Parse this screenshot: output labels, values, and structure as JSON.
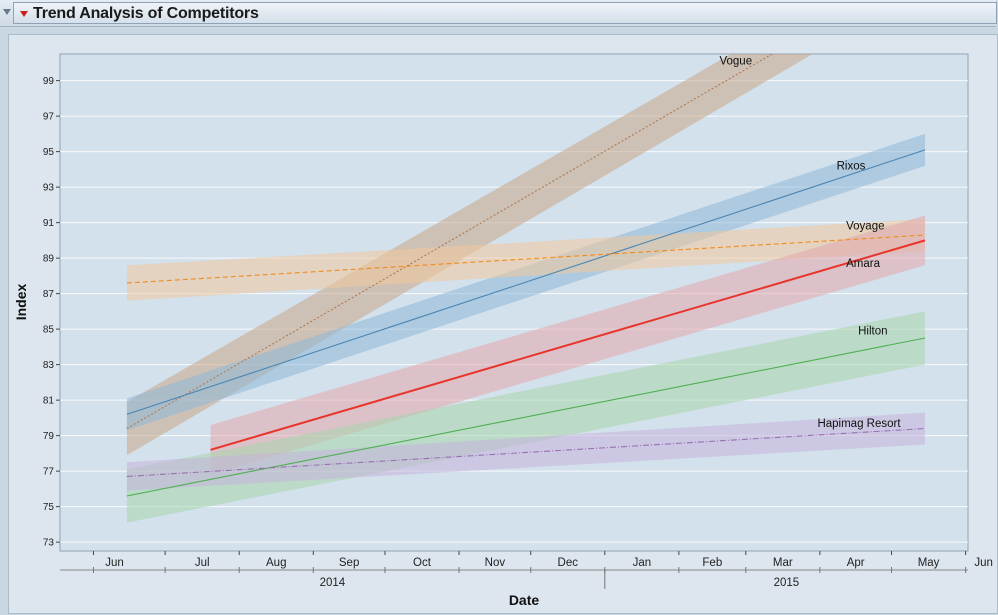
{
  "header": {
    "title": "Trend Analysis of Competitors"
  },
  "chart_data": {
    "type": "line",
    "title": "Trend Analysis of Competitors",
    "xlabel": "Date",
    "ylabel": "Index",
    "ylim": [
      72.5,
      100.5
    ],
    "xlim": [
      "2014-05-18",
      "2015-06-02"
    ],
    "y_ticks": [
      73,
      75,
      77,
      79,
      81,
      83,
      85,
      87,
      89,
      91,
      93,
      95,
      97,
      99
    ],
    "x_month_ticks": [
      {
        "label": "Jun",
        "date": "2014-06-01"
      },
      {
        "label": "Jul",
        "date": "2014-07-01"
      },
      {
        "label": "Aug",
        "date": "2014-08-01"
      },
      {
        "label": "Sep",
        "date": "2014-09-01"
      },
      {
        "label": "Oct",
        "date": "2014-10-01"
      },
      {
        "label": "Nov",
        "date": "2014-11-01"
      },
      {
        "label": "Dec",
        "date": "2014-12-01"
      },
      {
        "label": "Jan",
        "date": "2015-01-01"
      },
      {
        "label": "Feb",
        "date": "2015-02-01"
      },
      {
        "label": "Mar",
        "date": "2015-03-01"
      },
      {
        "label": "Apr",
        "date": "2015-04-01"
      },
      {
        "label": "May",
        "date": "2015-05-01"
      },
      {
        "label": "Jun",
        "date": "2015-06-01"
      }
    ],
    "x_year_labels": [
      {
        "label": "2014",
        "date": "2014-09-16"
      },
      {
        "label": "2015",
        "date": "2015-03-16"
      }
    ],
    "grid": true,
    "series": [
      {
        "name": "Vogue",
        "color": "#b07a4f",
        "band": "#c8a589",
        "dash": "2,2",
        "x": [
          "2014-06-15",
          "2015-05-15"
        ],
        "y": [
          79.4,
          105.5
        ],
        "band_halfwidth": [
          1.5,
          1.3
        ],
        "label_at": [
          "2015-02-18",
          99.9
        ]
      },
      {
        "name": "Rixos",
        "color": "#4a86b3",
        "band": "#8fb8d8",
        "dash": "",
        "x": [
          "2014-06-15",
          "2015-05-15"
        ],
        "y": [
          80.2,
          95.1
        ],
        "band_halfwidth": [
          0.9,
          0.9
        ],
        "label_at": [
          "2015-04-08",
          94.0
        ]
      },
      {
        "name": "Voyage",
        "color": "#f08c1e",
        "band": "#f1c99c",
        "dash": "5,3",
        "x": [
          "2014-06-15",
          "2015-05-15"
        ],
        "y": [
          87.6,
          90.3
        ],
        "band_halfwidth": [
          1.0,
          0.9
        ],
        "label_at": [
          "2015-04-12",
          90.6
        ]
      },
      {
        "name": "Amara",
        "color": "#e8352c",
        "band": "#e4a7ad",
        "dash": "",
        "width": 2,
        "x": [
          "2014-07-20",
          "2015-05-15"
        ],
        "y": [
          78.2,
          90.0
        ],
        "band_halfwidth": [
          1.4,
          1.4
        ],
        "label_at": [
          "2015-04-12",
          88.5
        ]
      },
      {
        "name": "Hilton",
        "color": "#4faf52",
        "band": "#a8d6ac",
        "dash": "",
        "x": [
          "2014-06-15",
          "2015-05-15"
        ],
        "y": [
          75.6,
          84.5
        ],
        "band_halfwidth": [
          1.5,
          1.5
        ],
        "label_at": [
          "2015-04-17",
          84.7
        ]
      },
      {
        "name": "Hapimag Resort",
        "color": "#9a6fb3",
        "band": "#c6b3dc",
        "dash": "6,2,1,2",
        "x": [
          "2014-06-15",
          "2015-05-15"
        ],
        "y": [
          76.7,
          79.4
        ],
        "band_halfwidth": [
          0.8,
          0.9
        ],
        "label_at": [
          "2015-03-31",
          79.5
        ]
      }
    ]
  }
}
